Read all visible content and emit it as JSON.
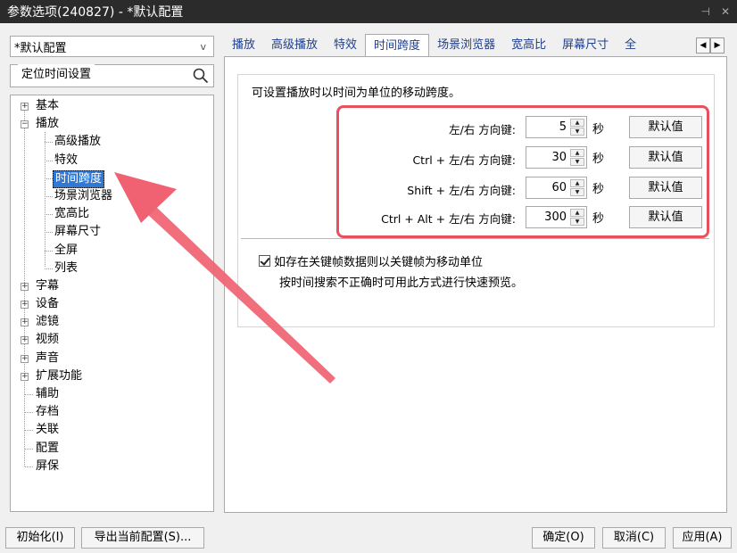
{
  "window": {
    "title": "参数选项(240827) - *默认配置",
    "controls": [
      "pin-icon",
      "close-icon"
    ]
  },
  "profile_select": {
    "value": "*默认配置"
  },
  "search": {
    "value": "",
    "placeholder": ""
  },
  "tree": {
    "items": [
      {
        "label": "基本",
        "expander": "+"
      },
      {
        "label": "播放",
        "expander": "-"
      },
      {
        "label": "高级播放"
      },
      {
        "label": "特效"
      },
      {
        "label": "时间跨度",
        "selected": true
      },
      {
        "label": "场景浏览器"
      },
      {
        "label": "宽高比"
      },
      {
        "label": "屏幕尺寸"
      },
      {
        "label": "全屏"
      },
      {
        "label": "列表"
      },
      {
        "label": "字幕",
        "expander": "+"
      },
      {
        "label": "设备",
        "expander": "+"
      },
      {
        "label": "滤镜",
        "expander": "+"
      },
      {
        "label": "视频",
        "expander": "+"
      },
      {
        "label": "声音",
        "expander": "+"
      },
      {
        "label": "扩展功能",
        "expander": "+"
      },
      {
        "label": "辅助"
      },
      {
        "label": "存档"
      },
      {
        "label": "关联"
      },
      {
        "label": "配置"
      },
      {
        "label": "屏保"
      }
    ]
  },
  "tabs": [
    "播放",
    "高级播放",
    "特效",
    "时间跨度",
    "场景浏览器",
    "宽高比",
    "屏幕尺寸",
    "全"
  ],
  "active_tab": "时间跨度",
  "group": {
    "title": "定位时间设置",
    "description": "可设置播放时以时间为单位的移动跨度。",
    "rows": [
      {
        "label": "左/右 方向键:",
        "value": "5",
        "unit": "秒",
        "default_label": "默认值"
      },
      {
        "label": "Ctrl + 左/右 方向键:",
        "value": "30",
        "unit": "秒",
        "default_label": "默认值"
      },
      {
        "label": "Shift + 左/右 方向键:",
        "value": "60",
        "unit": "秒",
        "default_label": "默认值"
      },
      {
        "label": "Ctrl + Alt + 左/右 方向键:",
        "value": "300",
        "unit": "秒",
        "default_label": "默认值"
      }
    ]
  },
  "keyframe_option": {
    "checked": true,
    "label": "如存在关键帧数据则以关键帧为移动单位",
    "description": "按时间搜索不正确时可用此方式进行快速预览。"
  },
  "buttons": {
    "init": "初始化(I)",
    "export": "导出当前配置(S)...",
    "ok": "确定(O)",
    "cancel": "取消(C)",
    "apply": "应用(A)"
  },
  "annotation": {
    "highlight_color": "#e8505e",
    "arrow_color": "#f06272"
  }
}
